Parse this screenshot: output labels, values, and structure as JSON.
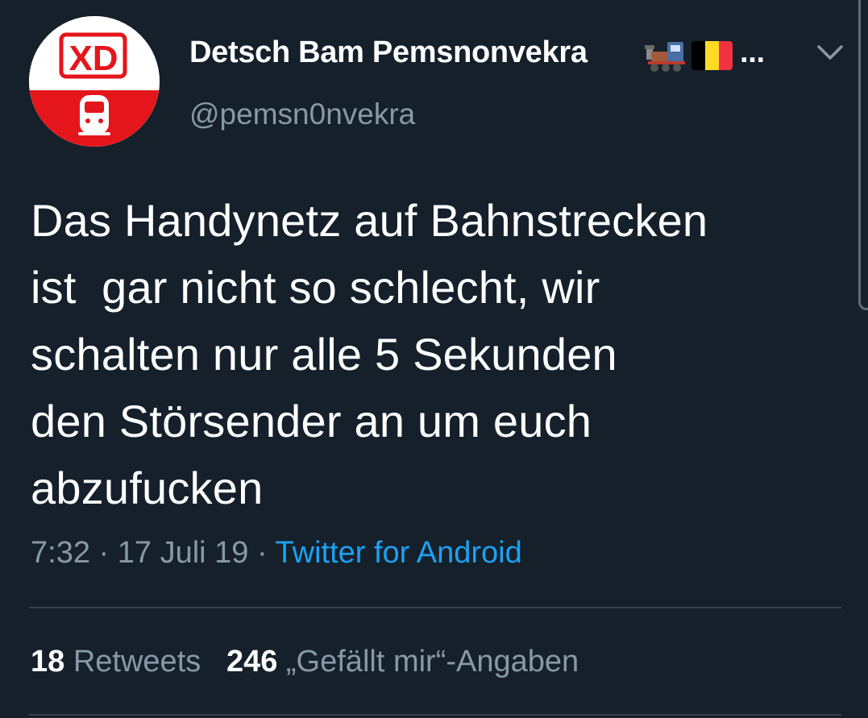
{
  "user": {
    "avatar_text": "XD",
    "display_name": "Detsch Bam Pemsnonvekra",
    "name_emojis": [
      "steam-locomotive-emoji",
      "belgium-flag-emoji"
    ],
    "name_overflow": "...",
    "handle": "@pemsn0nvekra"
  },
  "tweet": {
    "text": "Das Handynetz auf Bahnstrecken\nist  gar nicht so schlecht, wir\nschalten nur alle 5 Sekunden\nden Störsender an um euch\nabzufucken",
    "time": "7:32",
    "sep1": " · ",
    "date": "17 Juli 19",
    "sep2": " · ",
    "source": "Twitter for Android"
  },
  "stats": {
    "retweets_count": "18",
    "retweets_label": "Retweets",
    "likes_count": "246",
    "likes_label": "„Gefällt mir“-Angaben"
  },
  "colors": {
    "background": "#15202b",
    "text_primary": "#ffffff",
    "text_secondary": "#8899a6",
    "link": "#1da1f2",
    "divider": "#38444d",
    "avatar_red": "#e4161b"
  },
  "icons": {
    "more": "chevron-down-icon"
  }
}
